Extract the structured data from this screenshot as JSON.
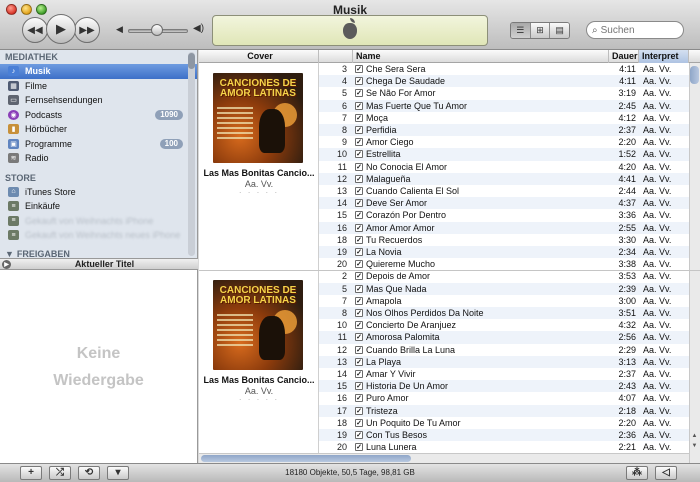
{
  "window": {
    "title": "Musik"
  },
  "search": {
    "placeholder": "Suchen"
  },
  "sidebar": {
    "sections": [
      {
        "header": "MEDIATHEK",
        "items": [
          {
            "label": "Musik",
            "icon": "music-note-icon",
            "selected": true
          },
          {
            "label": "Filme",
            "icon": "film-icon"
          },
          {
            "label": "Fernsehsendungen",
            "icon": "tv-icon"
          },
          {
            "label": "Podcasts",
            "icon": "podcast-icon",
            "badge": "1090"
          },
          {
            "label": "Hörbücher",
            "icon": "book-icon"
          },
          {
            "label": "Programme",
            "icon": "app-icon",
            "badge": "100"
          },
          {
            "label": "Radio",
            "icon": "radio-icon"
          }
        ]
      },
      {
        "header": "STORE",
        "items": [
          {
            "label": "iTunes Store",
            "icon": "store-icon"
          },
          {
            "label": "Einkäufe",
            "icon": "purchases-icon"
          },
          {
            "label": "Gekauft von Weihnachts iPhone",
            "icon": "purchases-icon",
            "blurred": true
          },
          {
            "label": "Gekauft von Weihnachts neues iPhone",
            "icon": "purchases-icon",
            "blurred": true
          }
        ]
      },
      {
        "header": "FREIGABEN",
        "items": []
      }
    ]
  },
  "now_playing": {
    "header": "Aktueller Titel",
    "empty_line1": "Keine",
    "empty_line2": "Wiedergabe"
  },
  "columns": {
    "cover": "Cover",
    "name": "Name",
    "dauer": "Dauer",
    "interpret": "Interpret"
  },
  "albums": [
    {
      "title": "Las Mas Bonitas Cancio...",
      "artist": "Aa. Vv.",
      "rating": "· · · · ·",
      "art_title": "CANCIONES DE AMOR LATINAS",
      "tracks": [
        {
          "num": "3",
          "name": "Che Sera Sera",
          "dauer": "4:11",
          "interp": "Aa. Vv."
        },
        {
          "num": "4",
          "name": "Chega De Saudade",
          "dauer": "4:11",
          "interp": "Aa. Vv."
        },
        {
          "num": "5",
          "name": "Se Não For Amor",
          "dauer": "3:19",
          "interp": "Aa. Vv."
        },
        {
          "num": "6",
          "name": "Mas Fuerte Que Tu Amor",
          "dauer": "2:45",
          "interp": "Aa. Vv."
        },
        {
          "num": "7",
          "name": "Moça",
          "dauer": "4:12",
          "interp": "Aa. Vv."
        },
        {
          "num": "8",
          "name": "Perfidia",
          "dauer": "2:37",
          "interp": "Aa. Vv."
        },
        {
          "num": "9",
          "name": "Amor Ciego",
          "dauer": "2:20",
          "interp": "Aa. Vv."
        },
        {
          "num": "10",
          "name": "Estrellita",
          "dauer": "1:52",
          "interp": "Aa. Vv."
        },
        {
          "num": "11",
          "name": "No Conocia El Amor",
          "dauer": "4:20",
          "interp": "Aa. Vv."
        },
        {
          "num": "12",
          "name": "Malagueña",
          "dauer": "4:41",
          "interp": "Aa. Vv."
        },
        {
          "num": "13",
          "name": "Cuando Calienta El Sol",
          "dauer": "2:44",
          "interp": "Aa. Vv."
        },
        {
          "num": "14",
          "name": "Deve Ser Amor",
          "dauer": "4:37",
          "interp": "Aa. Vv."
        },
        {
          "num": "15",
          "name": "Corazón Por Dentro",
          "dauer": "3:36",
          "interp": "Aa. Vv."
        },
        {
          "num": "16",
          "name": "Amor Amor Amor",
          "dauer": "2:55",
          "interp": "Aa. Vv."
        },
        {
          "num": "18",
          "name": "Tu Recuerdos",
          "dauer": "3:30",
          "interp": "Aa. Vv."
        },
        {
          "num": "19",
          "name": "La Novia",
          "dauer": "2:34",
          "interp": "Aa. Vv."
        },
        {
          "num": "20",
          "name": "Quiereme Mucho",
          "dauer": "3:38",
          "interp": "Aa. Vv."
        }
      ]
    },
    {
      "title": "Las Mas Bonitas Cancio...",
      "artist": "Aa. Vv.",
      "rating": "· · · · ·",
      "art_title": "CANCIONES DE AMOR LATINAS",
      "tracks": [
        {
          "num": "2",
          "name": "Depois de Amor",
          "dauer": "3:53",
          "interp": "Aa. Vv."
        },
        {
          "num": "5",
          "name": "Mas Que Nada",
          "dauer": "2:39",
          "interp": "Aa. Vv."
        },
        {
          "num": "7",
          "name": "Amapola",
          "dauer": "3:00",
          "interp": "Aa. Vv."
        },
        {
          "num": "8",
          "name": "Nos Olhos Perdidos Da Noite",
          "dauer": "3:51",
          "interp": "Aa. Vv."
        },
        {
          "num": "10",
          "name": "Concierto De Aranjuez",
          "dauer": "4:32",
          "interp": "Aa. Vv."
        },
        {
          "num": "11",
          "name": "Amorosa Palomita",
          "dauer": "2:56",
          "interp": "Aa. Vv."
        },
        {
          "num": "12",
          "name": "Cuando Brilla La Luna",
          "dauer": "2:29",
          "interp": "Aa. Vv."
        },
        {
          "num": "13",
          "name": "La Playa",
          "dauer": "3:13",
          "interp": "Aa. Vv."
        },
        {
          "num": "14",
          "name": "Amar Y Vivir",
          "dauer": "2:37",
          "interp": "Aa. Vv."
        },
        {
          "num": "15",
          "name": "Historia De Un Amor",
          "dauer": "2:43",
          "interp": "Aa. Vv."
        },
        {
          "num": "16",
          "name": "Puro Amor",
          "dauer": "4:07",
          "interp": "Aa. Vv."
        },
        {
          "num": "17",
          "name": "Tristeza",
          "dauer": "2:18",
          "interp": "Aa. Vv."
        },
        {
          "num": "18",
          "name": "Un Poquito De Tu Amor",
          "dauer": "2:20",
          "interp": "Aa. Vv."
        },
        {
          "num": "19",
          "name": "Con Tus Besos",
          "dauer": "2:36",
          "interp": "Aa. Vv."
        },
        {
          "num": "20",
          "name": "Luna Lunera",
          "dauer": "2:21",
          "interp": "Aa. Vv."
        }
      ]
    }
  ],
  "status": "18180 Objekte, 50,5 Tage, 98,81 GB",
  "colors": {
    "selection": "#3d70c8",
    "sidebar_bg": "#dfe5ed",
    "row_alt": "#eef3fa",
    "lcd": "#e6ebc4"
  }
}
